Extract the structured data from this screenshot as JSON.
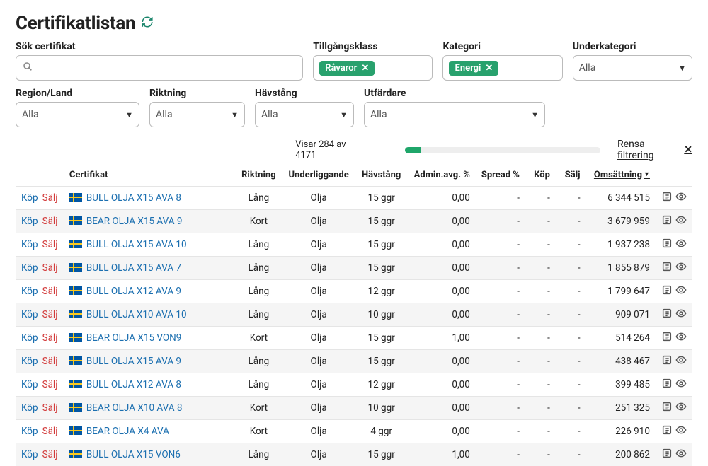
{
  "title": "Certifikatlistan",
  "filters_top": {
    "search": {
      "label": "Sök certifikat",
      "value": ""
    },
    "assetclass": {
      "label": "Tillgångsklass",
      "chip": "Råvaror"
    },
    "category": {
      "label": "Kategori",
      "chip": "Energi"
    },
    "subcategory": {
      "label": "Underkategori",
      "all": "Alla"
    }
  },
  "filters_bottom": {
    "region": {
      "label": "Region/Land",
      "all": "Alla"
    },
    "direction": {
      "label": "Riktning",
      "all": "Alla"
    },
    "leverage": {
      "label": "Hävstång",
      "all": "Alla"
    },
    "issuer": {
      "label": "Utfärdare",
      "all": "Alla"
    }
  },
  "status": {
    "text": "Visar 284 av 4171",
    "progress_pct": 8
  },
  "clear_filter": "Rensa filtrering",
  "headers": {
    "certificate": "Certifikat",
    "direction": "Riktning",
    "underlying": "Underliggande",
    "leverage": "Hävstång",
    "admin": "Admin.avg. %",
    "spread": "Spread %",
    "buy": "Köp",
    "sell": "Sälj",
    "turnover": "Omsättning"
  },
  "actions": {
    "buy": "Köp",
    "sell": "Sälj"
  },
  "rows": [
    {
      "name": "BULL OLJA X15 AVA 8",
      "dir": "Lång",
      "under": "Olja",
      "lev": "15 ggr",
      "admin": "0,00",
      "spread": "-",
      "buy": "-",
      "sell": "-",
      "oms": "6 344 515"
    },
    {
      "name": "BEAR OLJA X15 AVA 9",
      "dir": "Kort",
      "under": "Olja",
      "lev": "15 ggr",
      "admin": "0,00",
      "spread": "-",
      "buy": "-",
      "sell": "-",
      "oms": "3 679 959"
    },
    {
      "name": "BULL OLJA X15 AVA 10",
      "dir": "Lång",
      "under": "Olja",
      "lev": "15 ggr",
      "admin": "0,00",
      "spread": "-",
      "buy": "-",
      "sell": "-",
      "oms": "1 937 238"
    },
    {
      "name": "BULL OLJA X15 AVA 7",
      "dir": "Lång",
      "under": "Olja",
      "lev": "15 ggr",
      "admin": "0,00",
      "spread": "-",
      "buy": "-",
      "sell": "-",
      "oms": "1 855 879"
    },
    {
      "name": "BULL OLJA X12 AVA 9",
      "dir": "Lång",
      "under": "Olja",
      "lev": "12 ggr",
      "admin": "0,00",
      "spread": "-",
      "buy": "-",
      "sell": "-",
      "oms": "1 799 647"
    },
    {
      "name": "BULL OLJA X10 AVA 10",
      "dir": "Lång",
      "under": "Olja",
      "lev": "10 ggr",
      "admin": "0,00",
      "spread": "-",
      "buy": "-",
      "sell": "-",
      "oms": "909 071"
    },
    {
      "name": "BEAR OLJA X15 VON9",
      "dir": "Kort",
      "under": "Olja",
      "lev": "15 ggr",
      "admin": "1,00",
      "spread": "-",
      "buy": "-",
      "sell": "-",
      "oms": "514 264"
    },
    {
      "name": "BULL OLJA X15 AVA 9",
      "dir": "Lång",
      "under": "Olja",
      "lev": "15 ggr",
      "admin": "0,00",
      "spread": "-",
      "buy": "-",
      "sell": "-",
      "oms": "438 467"
    },
    {
      "name": "BULL OLJA X12 AVA 8",
      "dir": "Lång",
      "under": "Olja",
      "lev": "12 ggr",
      "admin": "0,00",
      "spread": "-",
      "buy": "-",
      "sell": "-",
      "oms": "399 485"
    },
    {
      "name": "BEAR OLJA X10 AVA 8",
      "dir": "Kort",
      "under": "Olja",
      "lev": "10 ggr",
      "admin": "0,00",
      "spread": "-",
      "buy": "-",
      "sell": "-",
      "oms": "251 325"
    },
    {
      "name": "BEAR OLJA X4 AVA",
      "dir": "Kort",
      "under": "Olja",
      "lev": "4 ggr",
      "admin": "0,00",
      "spread": "-",
      "buy": "-",
      "sell": "-",
      "oms": "226 910"
    },
    {
      "name": "BULL OLJA X15 VON6",
      "dir": "Lång",
      "under": "Olja",
      "lev": "15 ggr",
      "admin": "1,00",
      "spread": "-",
      "buy": "-",
      "sell": "-",
      "oms": "200 862"
    }
  ]
}
